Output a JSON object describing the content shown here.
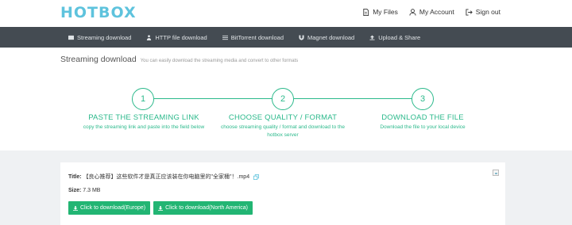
{
  "header": {
    "logo": "HOTBOX",
    "links": [
      {
        "label": "My Files"
      },
      {
        "label": "My Account"
      },
      {
        "label": "Sign out"
      }
    ]
  },
  "nav": {
    "items": [
      {
        "label": "Streaming download"
      },
      {
        "label": "HTTP file download"
      },
      {
        "label": "BitTorrent download"
      },
      {
        "label": "Magnet download"
      },
      {
        "label": "Upload & Share"
      }
    ]
  },
  "page": {
    "title": "Streaming download",
    "subtitle": "You can easily download the streaming media and convert to other formats"
  },
  "steps": [
    {
      "number": "1",
      "title": "PASTE THE STREAMING LINK",
      "desc": "copy the streaming link and paste into the field below"
    },
    {
      "number": "2",
      "title": "CHOOSE QUALITY / FORMAT",
      "desc": "choose streaming quality / format and download to the hotbox server"
    },
    {
      "number": "3",
      "title": "DOWNLOAD THE FILE",
      "desc": "Download the file to your local device"
    }
  ],
  "file": {
    "title_label": "Title:",
    "title_value": "【良心推荐】这些软件才是真正应该装在你电脑里的\"全家桶\"！.mp4",
    "size_label": "Size:",
    "size_value": "7.3 MB",
    "buttons": [
      {
        "label": "Click to download(Europe)"
      },
      {
        "label": "Click to download(North America)"
      }
    ]
  },
  "colors": {
    "accent": "#2bb98b",
    "button": "#22b573",
    "nav_bg": "#444b52",
    "logo": "#5ec3dd"
  }
}
